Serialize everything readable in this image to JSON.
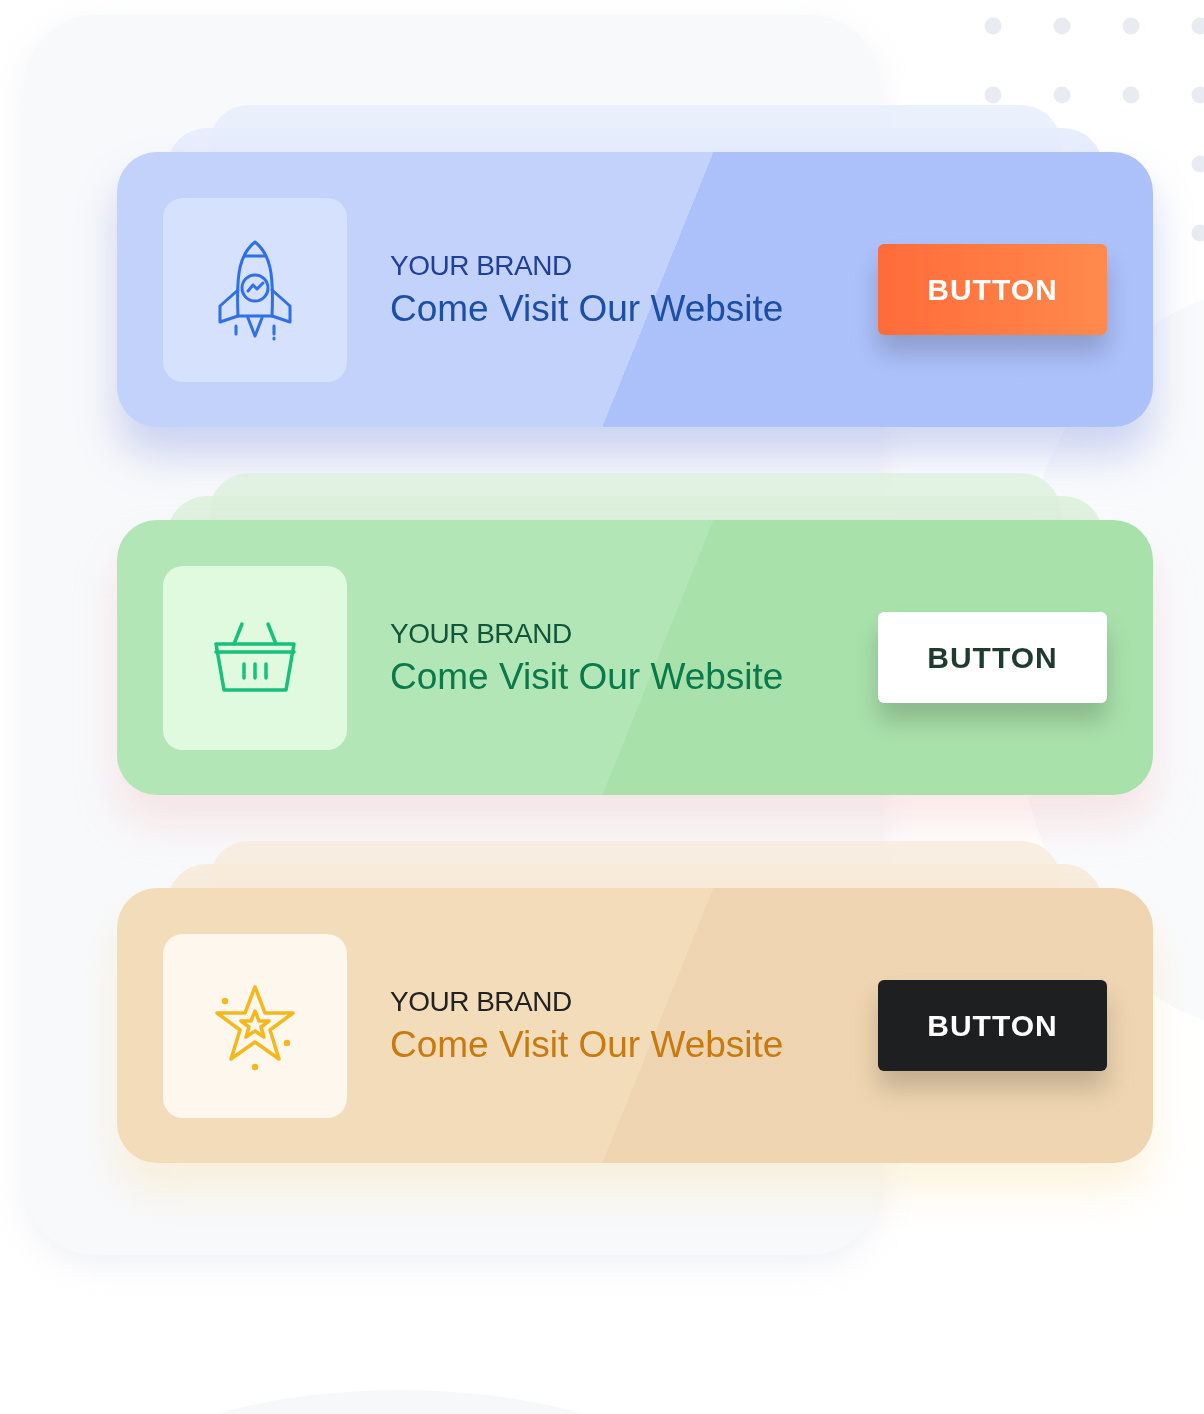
{
  "banners": [
    {
      "kind": "rocket",
      "color": "#c3d2fa",
      "brand": "YOUR BRAND",
      "headline": "Come Visit Our Website",
      "button": "BUTTON"
    },
    {
      "kind": "basket",
      "color": "#b3e6b6",
      "brand": "YOUR BRAND",
      "headline": "Come Visit Our Website",
      "button": "BUTTON"
    },
    {
      "kind": "star",
      "color": "#f3dcba",
      "brand": "YOUR BRAND",
      "headline": "Come Visit Our Website",
      "button": "BUTTON"
    }
  ]
}
